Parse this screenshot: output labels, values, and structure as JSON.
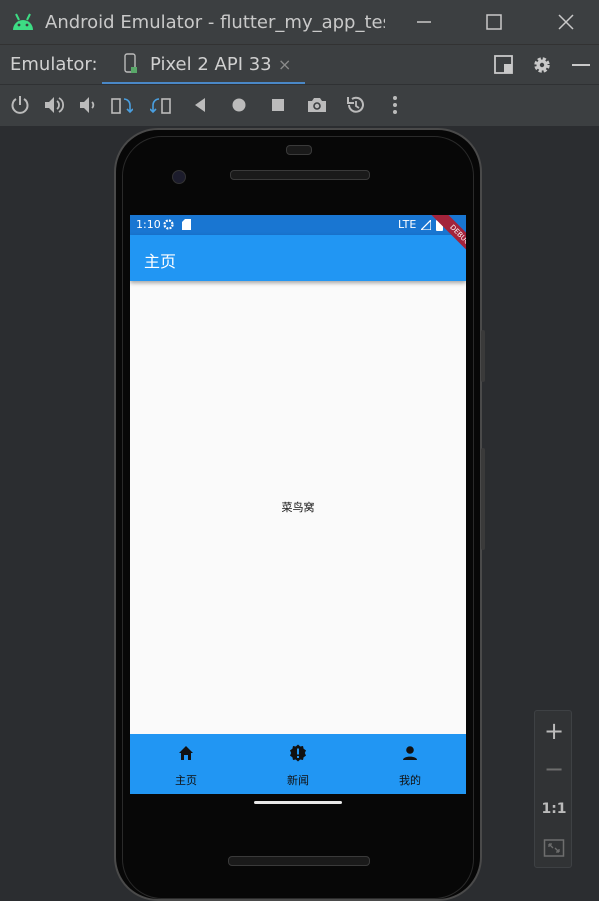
{
  "window": {
    "title": "Android Emulator - flutter_my_app_test",
    "app_icon": "android-icon",
    "controls": [
      "minimize-icon",
      "maximize-icon",
      "close-icon"
    ]
  },
  "tabbar": {
    "label": "Emulator:",
    "device_tab": {
      "label": "Pixel 2 API 33",
      "close": "×"
    },
    "right_icons": [
      "window-layout-icon",
      "gear-icon",
      "minus-icon"
    ]
  },
  "toolbar": {
    "tools": [
      "power-icon",
      "volume-up-icon",
      "volume-down-icon",
      "rotate-left-icon",
      "rotate-right-icon",
      "back-icon",
      "home-icon",
      "overview-icon",
      "camera-icon",
      "snapshot-icon",
      "more-icon"
    ]
  },
  "phone": {
    "status": {
      "time": "1:10",
      "network": "LTE"
    },
    "debug_banner": "DEBUG",
    "appbar_title": "主页",
    "body_text": "菜鸟窝",
    "nav": [
      {
        "label": "主页",
        "icon": "home-icon"
      },
      {
        "label": "新闻",
        "icon": "news-icon"
      },
      {
        "label": "我的",
        "icon": "person-icon"
      }
    ]
  },
  "zoom": {
    "zoom_in": "+",
    "zoom_out": "−",
    "one_to_one": "1:1",
    "fit": "fit-screen-icon"
  },
  "colors": {
    "appbar": "#2196f3",
    "statusbar": "#1976d2",
    "chrome": "#3c3f41",
    "tab_underline": "#4a88c7"
  }
}
